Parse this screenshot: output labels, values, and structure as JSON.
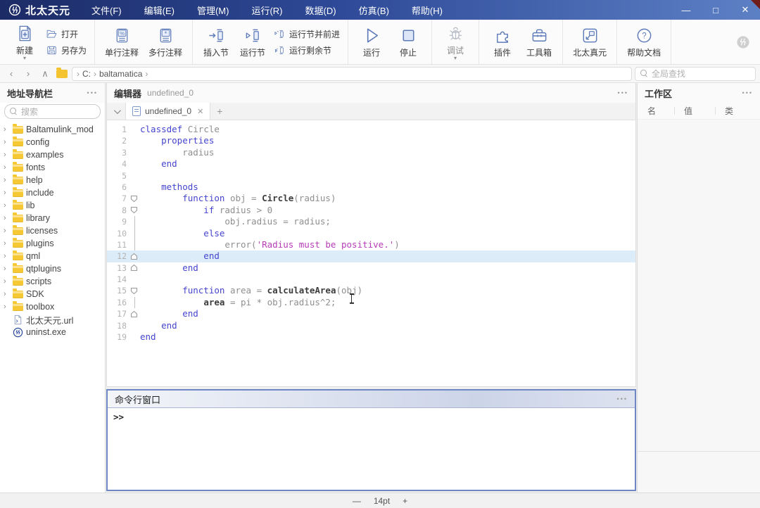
{
  "window": {
    "logo_text": "北太天元",
    "menus": [
      "文件(F)",
      "编辑(E)",
      "管理(M)",
      "运行(R)",
      "数据(D)",
      "仿真(B)",
      "帮助(H)"
    ],
    "controls": {
      "minimize": "—",
      "maximize": "□",
      "close": "✕"
    },
    "titlebar_gradient": [
      "#1c2b66",
      "#5d80c5"
    ]
  },
  "toolbar": {
    "groups": [
      {
        "big": [
          {
            "icon": "new-file",
            "label": "新建",
            "arrow": true
          }
        ],
        "stack": [
          {
            "icon": "open-folder",
            "label": "打开"
          },
          {
            "icon": "save-as",
            "label": "另存为"
          }
        ]
      },
      {
        "big": [
          {
            "icon": "comment-single",
            "label": "单行注释"
          },
          {
            "icon": "comment-multi",
            "label": "多行注释"
          }
        ]
      },
      {
        "big": [
          {
            "icon": "insert-section",
            "label": "插入节"
          },
          {
            "icon": "run-section",
            "label": "运行节"
          }
        ],
        "stack": [
          {
            "icon": "run-advance",
            "label": "运行节并前进"
          },
          {
            "icon": "run-remaining",
            "label": "运行剩余节"
          }
        ]
      },
      {
        "big": [
          {
            "icon": "run",
            "label": "运行"
          },
          {
            "icon": "stop",
            "label": "停止"
          }
        ]
      },
      {
        "big": [
          {
            "icon": "debug",
            "label": "调试",
            "arrow": true,
            "disabled": true
          }
        ]
      },
      {
        "big": [
          {
            "icon": "plugin",
            "label": "插件"
          },
          {
            "icon": "toolbox",
            "label": "工具箱"
          }
        ]
      },
      {
        "big": [
          {
            "icon": "bt-zhenyuan",
            "label": "北太真元"
          }
        ]
      },
      {
        "big": [
          {
            "icon": "help",
            "label": "帮助文档"
          }
        ]
      }
    ],
    "brand_icon": "brand-gray",
    "accent_color": "#5d7ab9"
  },
  "addressbar": {
    "breadcrumb": [
      "C:",
      "baltamatica"
    ],
    "global_search_placeholder": "全局查找"
  },
  "sidebar": {
    "title": "地址导航栏",
    "menu_icon": "•••",
    "search_placeholder": "搜索",
    "items": [
      {
        "label": "Baltamulink_mod",
        "type": "folder"
      },
      {
        "label": "config",
        "type": "folder"
      },
      {
        "label": "examples",
        "type": "folder"
      },
      {
        "label": "fonts",
        "type": "folder"
      },
      {
        "label": "help",
        "type": "folder"
      },
      {
        "label": "include",
        "type": "folder"
      },
      {
        "label": "lib",
        "type": "folder"
      },
      {
        "label": "library",
        "type": "folder"
      },
      {
        "label": "licenses",
        "type": "folder"
      },
      {
        "label": "plugins",
        "type": "folder"
      },
      {
        "label": "qml",
        "type": "folder"
      },
      {
        "label": "qtplugins",
        "type": "folder"
      },
      {
        "label": "scripts",
        "type": "folder"
      },
      {
        "label": "SDK",
        "type": "folder"
      },
      {
        "label": "toolbox",
        "type": "folder"
      },
      {
        "label": "北太天元.url",
        "type": "url"
      },
      {
        "label": "uninst.exe",
        "type": "exe"
      }
    ]
  },
  "editor": {
    "title": "编辑器",
    "subtitle": "undefined_0",
    "menu_icon": "•••",
    "tabs": [
      {
        "label": "undefined_0",
        "close": "✕",
        "active": true
      }
    ],
    "new_tab": "+"
  },
  "code": {
    "language": "matlab-like",
    "highlight_line": 12,
    "lines": [
      {
        "n": 1,
        "t": [
          [
            "kw",
            "classdef"
          ],
          [
            "id",
            " Circle"
          ]
        ]
      },
      {
        "n": 2,
        "t": [
          [
            "kw",
            "    properties"
          ]
        ]
      },
      {
        "n": 3,
        "t": [
          [
            "id",
            "        radius"
          ]
        ]
      },
      {
        "n": 4,
        "t": [
          [
            "kw",
            "    end"
          ]
        ]
      },
      {
        "n": 5,
        "t": []
      },
      {
        "n": 6,
        "t": [
          [
            "kw",
            "    methods"
          ]
        ]
      },
      {
        "n": 7,
        "m": "down",
        "t": [
          [
            "kw",
            "        function"
          ],
          [
            "id",
            " obj = "
          ],
          [
            "fn",
            "Circle"
          ],
          [
            "id",
            "(radius)"
          ]
        ]
      },
      {
        "n": 8,
        "m": "down",
        "t": [
          [
            "kw",
            "            if"
          ],
          [
            "id",
            " radius > 0"
          ]
        ]
      },
      {
        "n": 9,
        "conn": true,
        "t": [
          [
            "id",
            "                obj.radius = radius;"
          ]
        ]
      },
      {
        "n": 10,
        "conn": true,
        "t": [
          [
            "kw",
            "            else"
          ]
        ]
      },
      {
        "n": 11,
        "conn": true,
        "t": [
          [
            "id",
            "                error("
          ],
          [
            "str",
            "'Radius must be positive.'"
          ],
          [
            "id",
            ")"
          ]
        ]
      },
      {
        "n": 12,
        "m": "up",
        "hl": true,
        "t": [
          [
            "kw",
            "            end"
          ]
        ]
      },
      {
        "n": 13,
        "m": "up",
        "t": [
          [
            "kw",
            "        end"
          ]
        ]
      },
      {
        "n": 14,
        "t": []
      },
      {
        "n": 15,
        "m": "down",
        "t": [
          [
            "kw",
            "        function"
          ],
          [
            "id",
            " area = "
          ],
          [
            "fn",
            "calculateArea"
          ],
          [
            "id",
            "(ob"
          ],
          [
            "caret",
            ""
          ],
          [
            "id",
            "j)"
          ]
        ]
      },
      {
        "n": 16,
        "conn": true,
        "t": [
          [
            "id",
            "            "
          ],
          [
            "fn",
            "area"
          ],
          [
            "id",
            " = pi * obj.radius^2;"
          ]
        ]
      },
      {
        "n": 17,
        "m": "up",
        "t": [
          [
            "kw",
            "        end"
          ]
        ]
      },
      {
        "n": 18,
        "t": [
          [
            "kw",
            "    end"
          ]
        ]
      },
      {
        "n": 19,
        "t": [
          [
            "kw",
            "end"
          ]
        ]
      }
    ],
    "token_colors": {
      "keyword": "#4444cf",
      "identifier": "#8f8f8f",
      "function": "#3c3c3c",
      "string": "#b73cb7"
    }
  },
  "workspace": {
    "title": "工作区",
    "menu_icon": "•••",
    "columns": [
      "名",
      "值",
      "类"
    ],
    "rows": []
  },
  "command_window": {
    "title": "命令行窗口",
    "menu_icon": "•••",
    "prompt": ">>",
    "focus_border_color": "#6e87c4"
  },
  "statusbar": {
    "decrease": "—",
    "font_size": "14pt",
    "increase": "+"
  }
}
